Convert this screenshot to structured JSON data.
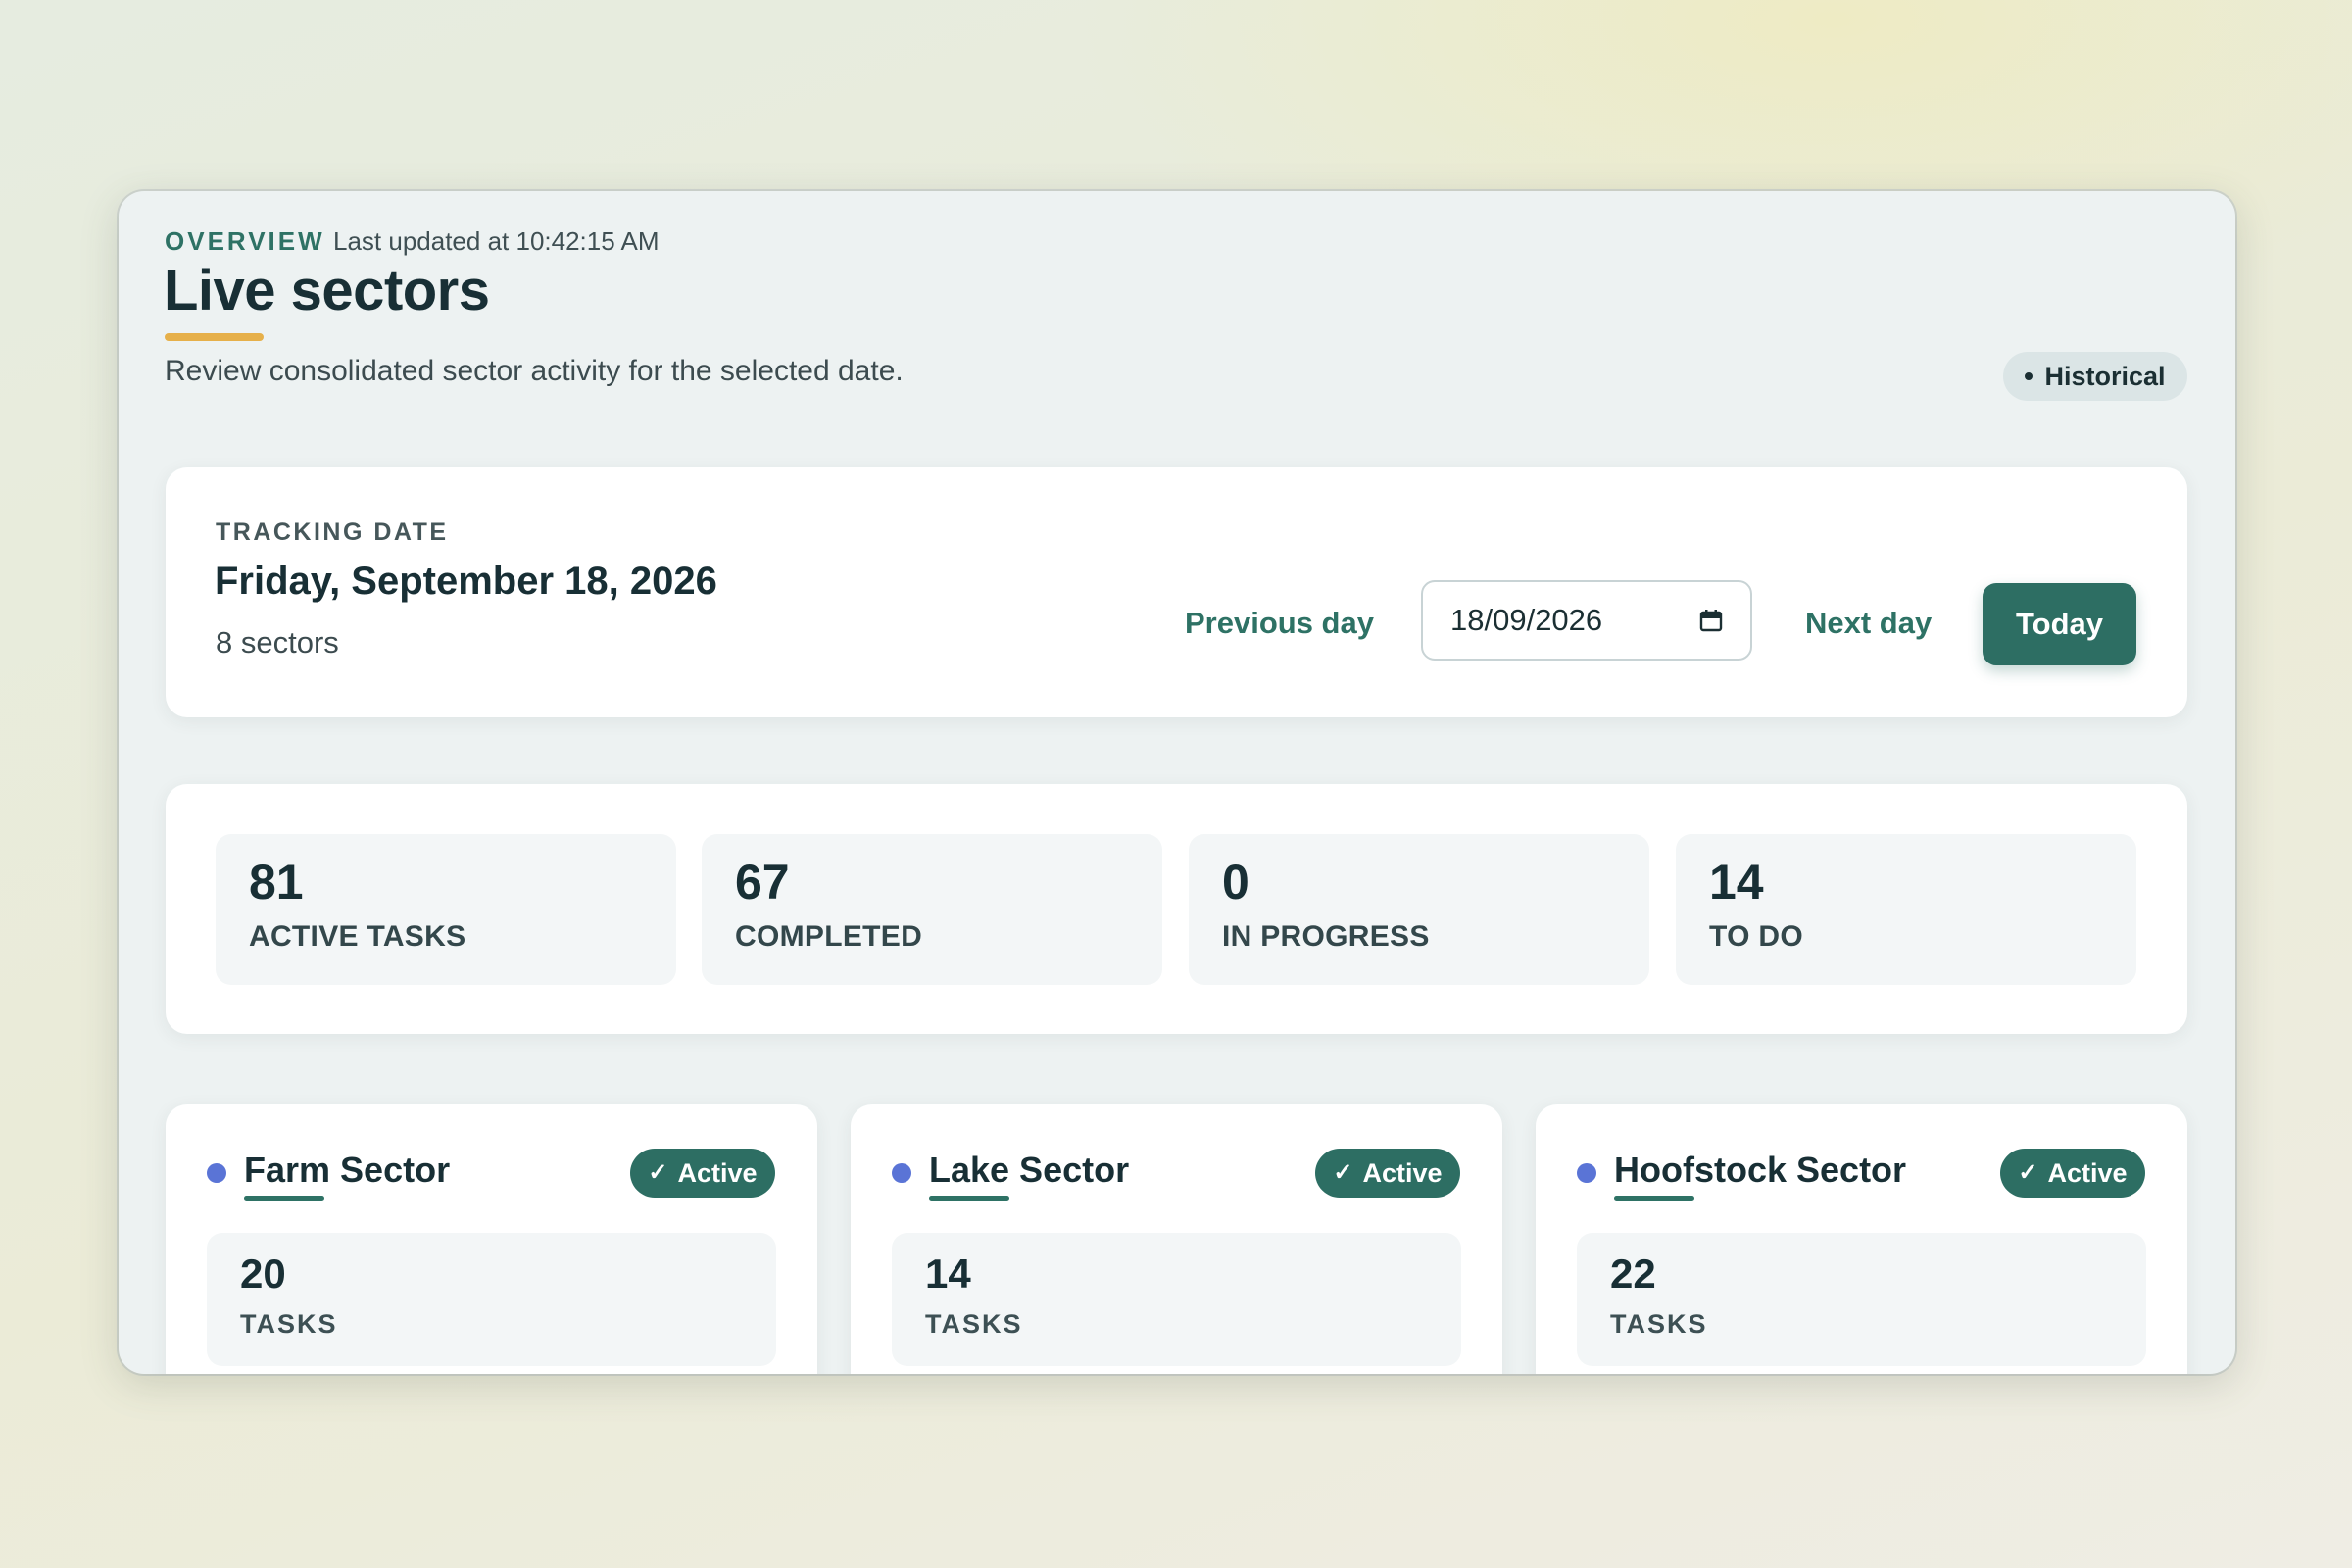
{
  "header": {
    "eyebrow": "OVERVIEW",
    "last_updated": "Last updated at 10:42:15 AM",
    "title": "Live sectors",
    "subtitle": "Review consolidated sector activity for the selected date.",
    "mode_badge": "Historical"
  },
  "tracking": {
    "label": "TRACKING DATE",
    "date_full": "Friday, September 18, 2026",
    "sector_count": "8 sectors",
    "prev_label": "Previous day",
    "date_value": "18/09/2026",
    "next_label": "Next day",
    "today_label": "Today"
  },
  "stats": [
    {
      "value": "81",
      "label": "ACTIVE TASKS"
    },
    {
      "value": "67",
      "label": "COMPLETED"
    },
    {
      "value": "0",
      "label": "IN PROGRESS"
    },
    {
      "value": "14",
      "label": "TO DO"
    }
  ],
  "sectors": [
    {
      "name": "Farm Sector",
      "status": "Active",
      "tasks": "20",
      "tasks_label": "TASKS"
    },
    {
      "name": "Lake Sector",
      "status": "Active",
      "tasks": "14",
      "tasks_label": "TASKS"
    },
    {
      "name": "Hoofstock Sector",
      "status": "Active",
      "tasks": "22",
      "tasks_label": "TASKS"
    }
  ],
  "icons": {
    "calendar": "calendar-icon",
    "check": "check-icon",
    "sector_dot": "status-dot-icon"
  },
  "colors": {
    "accent": "#2d6e63",
    "title_underline": "#e6b04a",
    "sector_dot": "#5a74d6"
  }
}
